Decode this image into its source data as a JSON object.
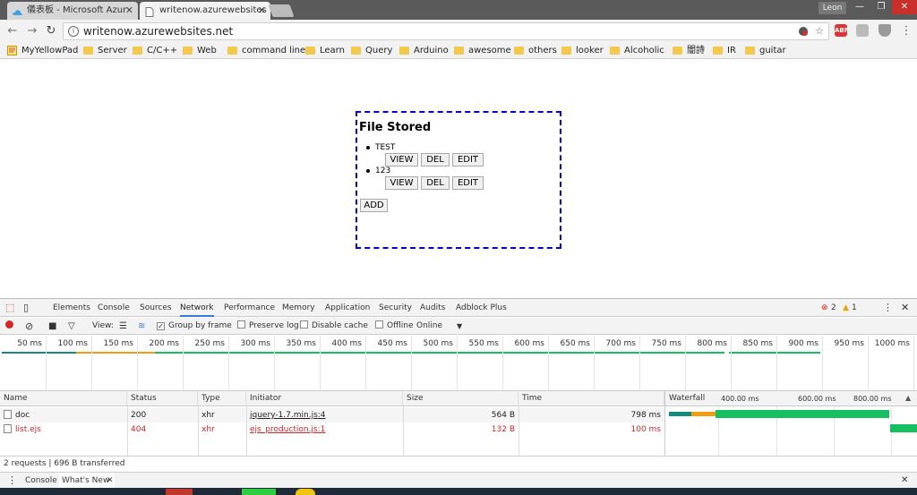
{
  "browser": {
    "tabs": [
      {
        "title": "儀表板 - Microsoft Azur",
        "active": false,
        "favicon": "azure-cloud-icon"
      },
      {
        "title": "writenow.azurewebsites",
        "active": true,
        "favicon": "page-icon"
      }
    ],
    "profile": "Leon",
    "window_controls": [
      "minimize",
      "restore",
      "close"
    ],
    "url": "writenow.azurewebsites.net",
    "extensions": [
      "ABP",
      "ext-gray",
      "shield"
    ],
    "bookmarks": [
      "MyYellowPad",
      "Server",
      "C/C++",
      "Web",
      "command line",
      "Learn",
      "Query",
      "Arduino",
      "awesome",
      "others",
      "looker",
      "Alcoholic",
      "闇詩",
      "IR",
      "guitar"
    ]
  },
  "page": {
    "heading": "File Stored",
    "files": [
      {
        "name": "TEST"
      },
      {
        "name": "123"
      }
    ],
    "buttons": {
      "view": "VIEW",
      "del": "DEL",
      "edit": "EDIT",
      "add": "ADD"
    },
    "border_color": "#0000cc"
  },
  "devtools": {
    "tabs": [
      "Elements",
      "Console",
      "Sources",
      "Network",
      "Performance",
      "Memory",
      "Application",
      "Security",
      "Audits",
      "Adblock Plus"
    ],
    "selected_tab": "Network",
    "errors": "2",
    "warnings": "1",
    "toolbar": {
      "view_label": "View:",
      "group_by_frame": "Group by frame",
      "preserve_log": "Preserve log",
      "disable_cache": "Disable cache",
      "offline": "Offline",
      "throttle": "Online"
    },
    "overview_ticks": [
      "50 ms",
      "100 ms",
      "150 ms",
      "200 ms",
      "250 ms",
      "300 ms",
      "350 ms",
      "400 ms",
      "450 ms",
      "500 ms",
      "550 ms",
      "600 ms",
      "650 ms",
      "700 ms",
      "750 ms",
      "800 ms",
      "850 ms",
      "900 ms",
      "950 ms",
      "1000 ms"
    ],
    "columns": {
      "name": "Name",
      "status": "Status",
      "type": "Type",
      "initiator": "Initiator",
      "size": "Size",
      "time": "Time",
      "waterfall": "Waterfall"
    },
    "waterfall_ticks": [
      "400.00 ms",
      "600.00 ms",
      "800.00 ms"
    ],
    "requests": [
      {
        "name": "doc",
        "status": "200",
        "type": "xhr",
        "initiator": "jquery-1.7.min.js:4",
        "size": "564 B",
        "time": "798 ms",
        "error": false
      },
      {
        "name": "list.ejs",
        "status": "404",
        "type": "xhr",
        "initiator": "ejs_production.js:1",
        "size": "132 B",
        "time": "100 ms",
        "error": true
      }
    ],
    "summary": "2 requests  |  696 B transferred",
    "drawer_tabs": [
      "Console",
      "What's New"
    ],
    "colors": {
      "green": "#16c060",
      "teal": "#158a7f",
      "orange": "#f39c12",
      "error": "#d12727",
      "selected_tab_underline": "#3879d9"
    }
  }
}
